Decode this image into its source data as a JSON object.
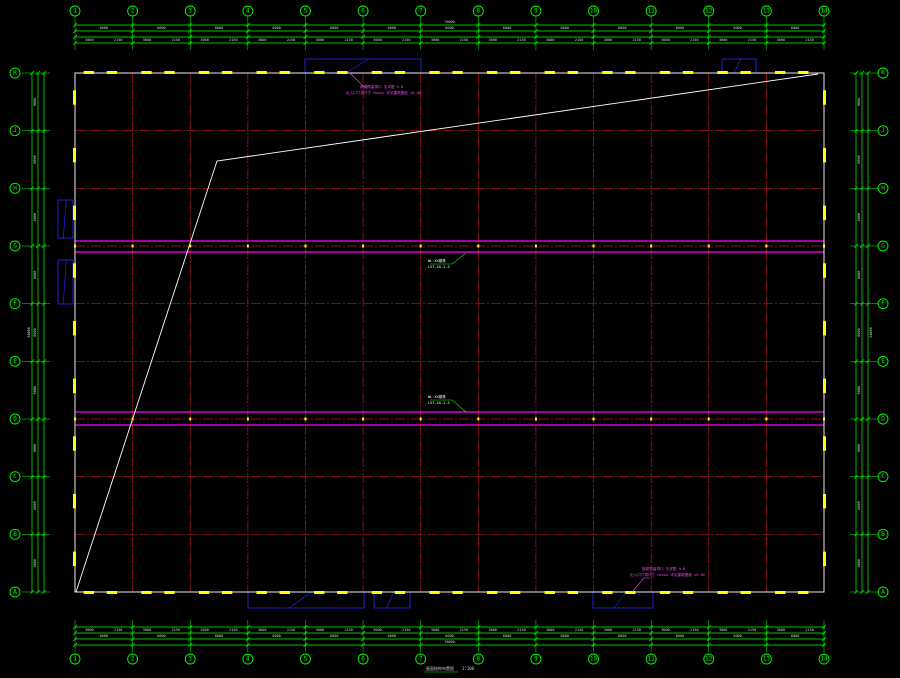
{
  "drawing": {
    "colors": {
      "background": "#000000",
      "axis_green": "#00ff00",
      "grid_red": "#c01818",
      "boundary_white": "#ffffff",
      "purlin_magenta": "#ff00ff",
      "column_yellow": "#ffff00",
      "opening_blue": "#2a2aff"
    },
    "column_axes": [
      "1",
      "2",
      "3",
      "4",
      "5",
      "6",
      "7",
      "8",
      "9",
      "10",
      "11",
      "12",
      "13",
      "14"
    ],
    "row_axes": [
      "K",
      "J",
      "H",
      "G",
      "F",
      "E",
      "D",
      "C",
      "B",
      "A"
    ],
    "dim_top_overall": "76000",
    "dim_top_segments": [
      "6000",
      "6000",
      "6000",
      "6000",
      "6000",
      "6000",
      "6000",
      "6000",
      "6000",
      "6000",
      "6000",
      "6000",
      "6000"
    ],
    "dim_top_sub": [
      "3000",
      "2150",
      "3000",
      "2150",
      "3000",
      "2150",
      "3000",
      "2150",
      "3000",
      "2150",
      "3000",
      "2150",
      "3000",
      "2150",
      "3000",
      "2150",
      "3000",
      "2150",
      "3000",
      "2150",
      "3000",
      "2150",
      "3000",
      "2150",
      "3000",
      "2150"
    ],
    "dim_bottom_overall": "76000",
    "dim_bottom_segments": [
      "6000",
      "6000",
      "6000",
      "6000",
      "6000",
      "6000",
      "6000",
      "6000",
      "6000",
      "6000",
      "6000",
      "6000",
      "6000"
    ],
    "dim_bottom_sub": [
      "3000",
      "2150",
      "3000",
      "2150",
      "3000",
      "2150",
      "3000",
      "2150",
      "3000",
      "2150",
      "3000",
      "2150",
      "3000",
      "2150",
      "3000",
      "2150",
      "3000",
      "2150",
      "3000",
      "2150",
      "3000",
      "2150",
      "3000",
      "2150",
      "3000",
      "2150"
    ],
    "dim_left_overall": "54000",
    "dim_left_segments": [
      "6000",
      "6000",
      "6000",
      "6000",
      "6000",
      "6000",
      "6000",
      "6000",
      "6000"
    ],
    "dim_right_overall": "54000",
    "dim_right_segments": [
      "6000",
      "6000",
      "6000",
      "6000",
      "6000",
      "6000",
      "6000",
      "6000",
      "6000"
    ],
    "notes": {
      "top_door_1": "钢梁预留洞口 见详图 H-B",
      "top_door_2": "出入口门洞尺寸 Hxxxx  详见建筑图纸 ±0.00",
      "purlin_1a": "WL-XX檩条",
      "purlin_1b": "LXT-XX-2.5",
      "purlin_2a": "WL-XX檩条",
      "purlin_2b": "LXT-XX-2.5",
      "bottom_door_1": "钢梁预留洞口 见详图 H-B",
      "bottom_door_2": "出入口门洞尺寸 Hxxxx  详见建筑图纸 ±0.00"
    },
    "footer_title": "屋面结构布置图",
    "footer_scale": "1:100"
  }
}
